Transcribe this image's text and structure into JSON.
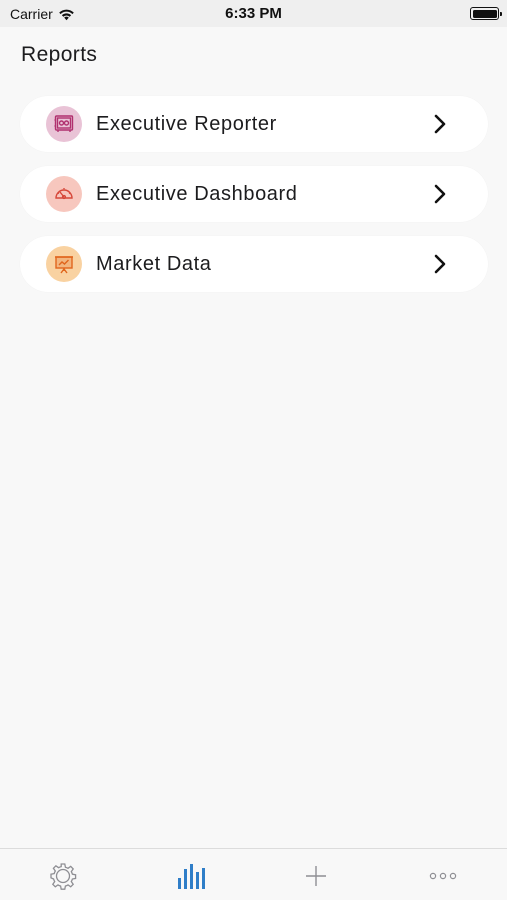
{
  "status_bar": {
    "carrier": "Carrier",
    "time": "6:33 PM"
  },
  "page": {
    "title": "Reports"
  },
  "reports": [
    {
      "label": "Executive Reporter",
      "icon": "safe-icon",
      "icon_bg": "#e9c3d6",
      "icon_color": "#b0306e"
    },
    {
      "label": "Executive Dashboard",
      "icon": "gauge-icon",
      "icon_bg": "#f7c7be",
      "icon_color": "#d6483a"
    },
    {
      "label": "Market Data",
      "icon": "presentation-icon",
      "icon_bg": "#f9d2a1",
      "icon_color": "#e0651c"
    }
  ],
  "tab_bar": {
    "tabs": [
      {
        "name": "settings",
        "icon": "gear-icon",
        "active": false
      },
      {
        "name": "reports",
        "icon": "bar-chart-icon",
        "active": true
      },
      {
        "name": "add",
        "icon": "plus-icon",
        "active": false
      },
      {
        "name": "more",
        "icon": "ellipsis-icon",
        "active": false
      }
    ],
    "active_color": "#2f7ec8",
    "inactive_color": "#8e8e93"
  }
}
